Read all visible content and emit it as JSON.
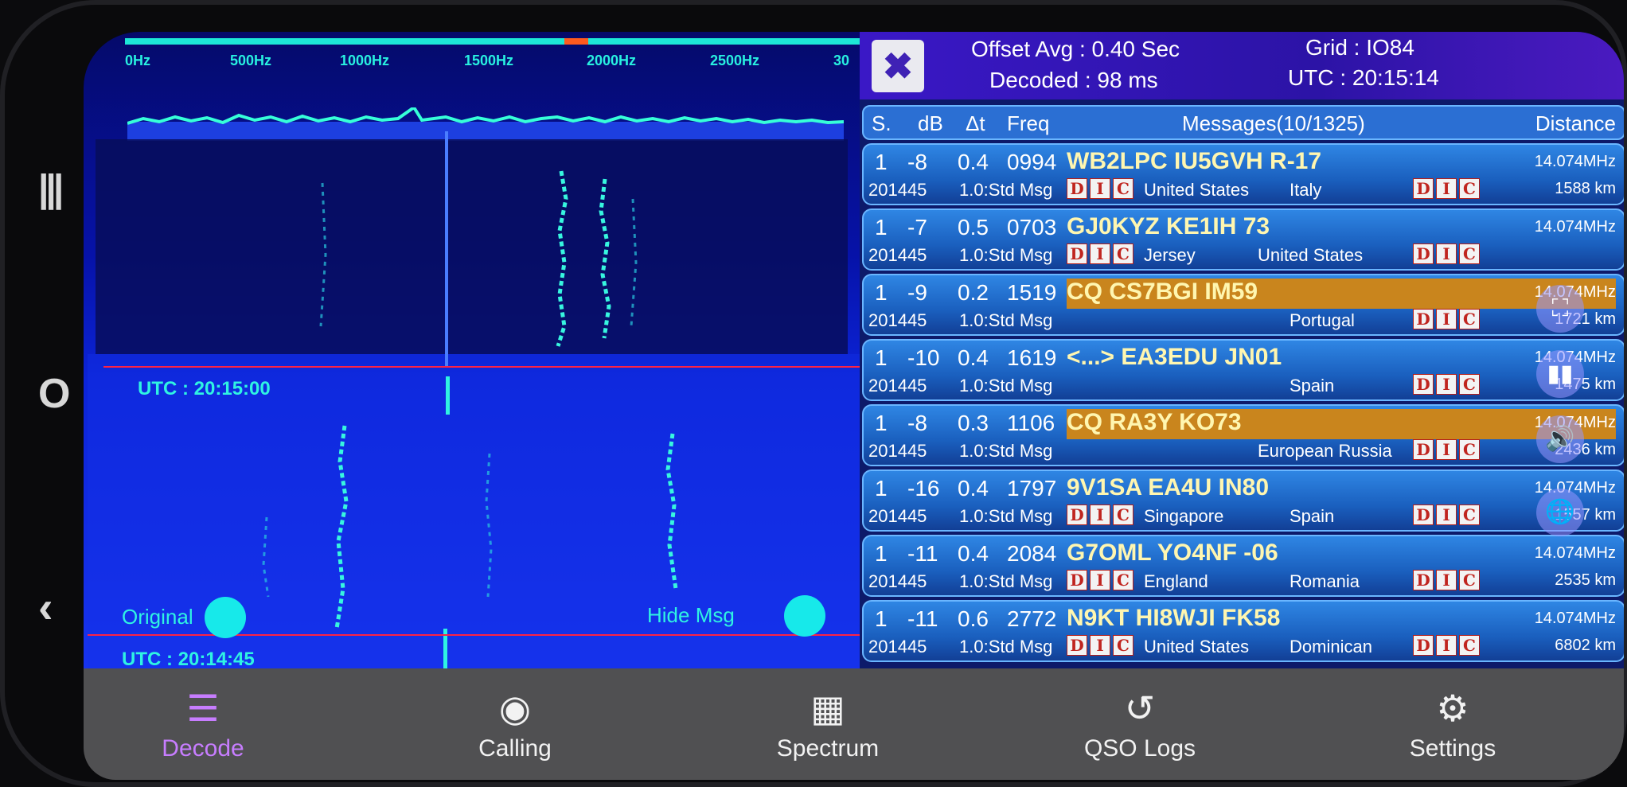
{
  "waterfall": {
    "freq_ticks": [
      "0Hz",
      "500Hz",
      "1000Hz",
      "1500Hz",
      "2000Hz",
      "2500Hz",
      "30"
    ],
    "utc_top": "UTC : 20:15:00",
    "utc_bottom": "UTC : 20:14:45",
    "original_label": "Original",
    "hide_msg_label": "Hide Msg"
  },
  "header": {
    "offset_avg": "Offset Avg : 0.40 Sec",
    "decoded": "Decoded : 98 ms",
    "grid": "Grid : IO84",
    "utc": "UTC : 20:15:14"
  },
  "columns": {
    "s": "S.",
    "db": "dB",
    "dt": "Δt",
    "freq": "Freq",
    "messages": "Messages(10/1325)",
    "distance": "Distance"
  },
  "dic": [
    "D",
    "I",
    "C"
  ],
  "rows": [
    {
      "s": "1",
      "db": "-8",
      "dt": "0.4",
      "freq": "0994",
      "msg": "WB2LPC IU5GVH R-17",
      "highlight": false,
      "time": "201445",
      "mode": "1.0:Std Msg",
      "from": "United States",
      "to": "Italy",
      "band": "14.074MHz",
      "dist": "1588 km"
    },
    {
      "s": "1",
      "db": "-7",
      "dt": "0.5",
      "freq": "0703",
      "msg": "GJ0KYZ KE1IH 73",
      "highlight": false,
      "time": "201445",
      "mode": "1.0:Std Msg",
      "from": "Jersey",
      "to": "United States",
      "band": "14.074MHz",
      "dist": ""
    },
    {
      "s": "1",
      "db": "-9",
      "dt": "0.2",
      "freq": "1519",
      "msg": "CQ CS7BGI IM59",
      "highlight": true,
      "time": "201445",
      "mode": "1.0:Std Msg",
      "from": "",
      "to": "Portugal",
      "band": "14.074MHz",
      "dist": "1721 km"
    },
    {
      "s": "1",
      "db": "-10",
      "dt": "0.4",
      "freq": "1619",
      "msg": "<...> EA3EDU JN01",
      "highlight": false,
      "time": "201445",
      "mode": "1.0:Std Msg",
      "from": "",
      "to": "Spain",
      "band": "14.074MHz",
      "dist": "1475 km"
    },
    {
      "s": "1",
      "db": "-8",
      "dt": "0.3",
      "freq": "1106",
      "msg": "CQ RA3Y KO73",
      "highlight": true,
      "time": "201445",
      "mode": "1.0:Std Msg",
      "from": "",
      "to": "European Russia",
      "band": "14.074MHz",
      "dist": "2436 km"
    },
    {
      "s": "1",
      "db": "-16",
      "dt": "0.4",
      "freq": "1797",
      "msg": "9V1SA EA4U IN80",
      "highlight": false,
      "time": "201445",
      "mode": "1.0:Std Msg",
      "from": "Singapore",
      "to": "Spain",
      "band": "14.074MHz",
      "dist": "1557 km"
    },
    {
      "s": "1",
      "db": "-11",
      "dt": "0.4",
      "freq": "2084",
      "msg": "G7OML YO4NF -06",
      "highlight": false,
      "time": "201445",
      "mode": "1.0:Std Msg",
      "from": "England",
      "to": "Romania",
      "band": "14.074MHz",
      "dist": "2535 km"
    },
    {
      "s": "1",
      "db": "-11",
      "dt": "0.6",
      "freq": "2772",
      "msg": "N9KT HI8WJI FK58",
      "highlight": false,
      "time": "201445",
      "mode": "1.0:Std Msg",
      "from": "United States",
      "to": "Dominican",
      "band": "14.074MHz",
      "dist": "6802 km"
    }
  ],
  "nav": [
    {
      "label": "Decode",
      "icon": "list-icon",
      "active": true
    },
    {
      "label": "Calling",
      "icon": "broadcast-icon",
      "active": false
    },
    {
      "label": "Spectrum",
      "icon": "spectrum-icon",
      "active": false
    },
    {
      "label": "QSO Logs",
      "icon": "history-icon",
      "active": false
    },
    {
      "label": "Settings",
      "icon": "gear-icon",
      "active": false
    }
  ],
  "colors": {
    "accent_active": "#c77dff",
    "waterfall_trace": "#2ff3e2",
    "highlight": "#c9851d",
    "row_blue": "#1a5fbe"
  }
}
